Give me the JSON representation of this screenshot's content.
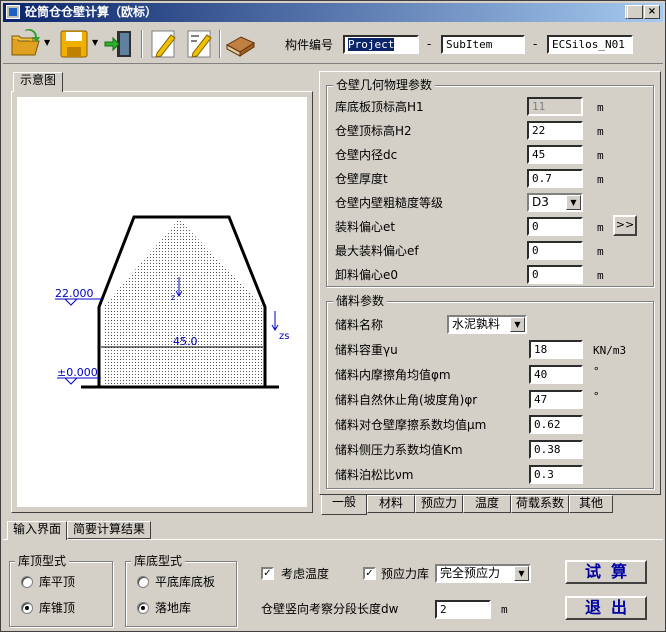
{
  "window": {
    "title": "砼筒仓仓壁计算（欧标）",
    "min": "_",
    "max": "□",
    "close": "×"
  },
  "toolbar": {
    "icons": [
      "open-folder-icon",
      "save-disk-icon",
      "exit-door-icon",
      "edit-note-icon",
      "edit-note-2-icon",
      "book-icon"
    ],
    "component_label": "构件编号",
    "project": "Project",
    "subitem": "SubItem",
    "silo": "ECSilos_N01",
    "dash": "-"
  },
  "left_panel": {
    "tab": "示意图",
    "diagram": {
      "h1_label": "22.000",
      "dc_label": "45.0",
      "base_label": "±0.000",
      "zs_label": "zs",
      "z_label": "z"
    }
  },
  "geometry": {
    "title": "仓壁几何物理参数",
    "rows": [
      {
        "label": "库底板顶标高H1",
        "value": "11",
        "unit": "m",
        "disabled": true
      },
      {
        "label": "仓壁顶标高H2",
        "value": "22",
        "unit": "m"
      },
      {
        "label": "仓壁内径dc",
        "value": "45",
        "unit": "m"
      },
      {
        "label": "仓壁厚度t",
        "value": "0.7",
        "unit": "m"
      },
      {
        "label": "仓壁内壁粗糙度等级",
        "value": "D3",
        "unit": ""
      },
      {
        "label": "装料偏心et",
        "value": "0",
        "unit": "m"
      },
      {
        "label": "最大装料偏心ef",
        "value": "0",
        "unit": "m"
      },
      {
        "label": "卸料偏心e0",
        "value": "0",
        "unit": "m"
      }
    ],
    "more_button": ">>"
  },
  "storage": {
    "title": "储料参数",
    "name_label": "储料名称",
    "name_value": "水泥孰料",
    "rows": [
      {
        "label": "储料容重γu",
        "value": "18",
        "unit": "KN/m3"
      },
      {
        "label": "储料内摩擦角均值φm",
        "value": "40",
        "unit": "°"
      },
      {
        "label": "储料自然休止角(坡度角)φr",
        "value": "47",
        "unit": "°"
      },
      {
        "label": "储料对仓壁摩擦系数均值μm",
        "value": "0.62",
        "unit": ""
      },
      {
        "label": "储料侧压力系数均值Km",
        "value": "0.38",
        "unit": ""
      },
      {
        "label": "储料泊松比νm",
        "value": "0.3",
        "unit": ""
      }
    ]
  },
  "right_tabs": [
    "一般",
    "材料",
    "预应力",
    "温度",
    "荷载系数",
    "其他"
  ],
  "bottom_tabs": [
    "输入界面",
    "简要计算结果"
  ],
  "roof": {
    "title": "库顶型式",
    "options": [
      "库平顶",
      "库锥顶"
    ],
    "selected": 1
  },
  "base": {
    "title": "库底型式",
    "options": [
      "平底库底板",
      "落地库"
    ],
    "selected": 1
  },
  "options": {
    "temp_label": "考虑温度",
    "temp_checked": true,
    "prestress_label": "预应力库",
    "prestress_checked": true,
    "prestress_type": "完全预应力",
    "segment_label": "仓壁竖向考察分段长度dw",
    "segment_value": "2",
    "segment_unit": "m"
  },
  "buttons": {
    "calc": "试算",
    "exit": "退出"
  }
}
